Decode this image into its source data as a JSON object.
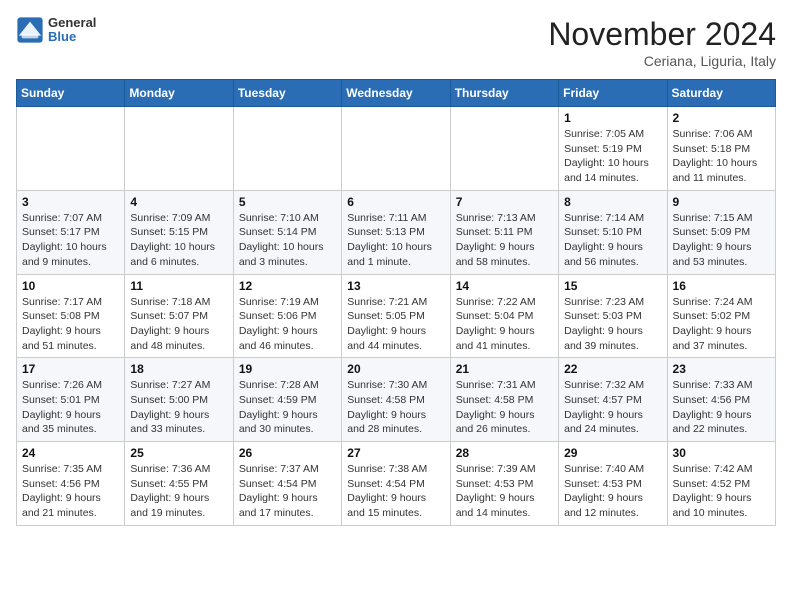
{
  "header": {
    "logo": {
      "general": "General",
      "blue": "Blue"
    },
    "month": "November 2024",
    "location": "Ceriana, Liguria, Italy"
  },
  "weekdays": [
    "Sunday",
    "Monday",
    "Tuesday",
    "Wednesday",
    "Thursday",
    "Friday",
    "Saturday"
  ],
  "weeks": [
    [
      {
        "day": "",
        "info": ""
      },
      {
        "day": "",
        "info": ""
      },
      {
        "day": "",
        "info": ""
      },
      {
        "day": "",
        "info": ""
      },
      {
        "day": "",
        "info": ""
      },
      {
        "day": "1",
        "info": "Sunrise: 7:05 AM\nSunset: 5:19 PM\nDaylight: 10 hours and 14 minutes."
      },
      {
        "day": "2",
        "info": "Sunrise: 7:06 AM\nSunset: 5:18 PM\nDaylight: 10 hours and 11 minutes."
      }
    ],
    [
      {
        "day": "3",
        "info": "Sunrise: 7:07 AM\nSunset: 5:17 PM\nDaylight: 10 hours and 9 minutes."
      },
      {
        "day": "4",
        "info": "Sunrise: 7:09 AM\nSunset: 5:15 PM\nDaylight: 10 hours and 6 minutes."
      },
      {
        "day": "5",
        "info": "Sunrise: 7:10 AM\nSunset: 5:14 PM\nDaylight: 10 hours and 3 minutes."
      },
      {
        "day": "6",
        "info": "Sunrise: 7:11 AM\nSunset: 5:13 PM\nDaylight: 10 hours and 1 minute."
      },
      {
        "day": "7",
        "info": "Sunrise: 7:13 AM\nSunset: 5:11 PM\nDaylight: 9 hours and 58 minutes."
      },
      {
        "day": "8",
        "info": "Sunrise: 7:14 AM\nSunset: 5:10 PM\nDaylight: 9 hours and 56 minutes."
      },
      {
        "day": "9",
        "info": "Sunrise: 7:15 AM\nSunset: 5:09 PM\nDaylight: 9 hours and 53 minutes."
      }
    ],
    [
      {
        "day": "10",
        "info": "Sunrise: 7:17 AM\nSunset: 5:08 PM\nDaylight: 9 hours and 51 minutes."
      },
      {
        "day": "11",
        "info": "Sunrise: 7:18 AM\nSunset: 5:07 PM\nDaylight: 9 hours and 48 minutes."
      },
      {
        "day": "12",
        "info": "Sunrise: 7:19 AM\nSunset: 5:06 PM\nDaylight: 9 hours and 46 minutes."
      },
      {
        "day": "13",
        "info": "Sunrise: 7:21 AM\nSunset: 5:05 PM\nDaylight: 9 hours and 44 minutes."
      },
      {
        "day": "14",
        "info": "Sunrise: 7:22 AM\nSunset: 5:04 PM\nDaylight: 9 hours and 41 minutes."
      },
      {
        "day": "15",
        "info": "Sunrise: 7:23 AM\nSunset: 5:03 PM\nDaylight: 9 hours and 39 minutes."
      },
      {
        "day": "16",
        "info": "Sunrise: 7:24 AM\nSunset: 5:02 PM\nDaylight: 9 hours and 37 minutes."
      }
    ],
    [
      {
        "day": "17",
        "info": "Sunrise: 7:26 AM\nSunset: 5:01 PM\nDaylight: 9 hours and 35 minutes."
      },
      {
        "day": "18",
        "info": "Sunrise: 7:27 AM\nSunset: 5:00 PM\nDaylight: 9 hours and 33 minutes."
      },
      {
        "day": "19",
        "info": "Sunrise: 7:28 AM\nSunset: 4:59 PM\nDaylight: 9 hours and 30 minutes."
      },
      {
        "day": "20",
        "info": "Sunrise: 7:30 AM\nSunset: 4:58 PM\nDaylight: 9 hours and 28 minutes."
      },
      {
        "day": "21",
        "info": "Sunrise: 7:31 AM\nSunset: 4:58 PM\nDaylight: 9 hours and 26 minutes."
      },
      {
        "day": "22",
        "info": "Sunrise: 7:32 AM\nSunset: 4:57 PM\nDaylight: 9 hours and 24 minutes."
      },
      {
        "day": "23",
        "info": "Sunrise: 7:33 AM\nSunset: 4:56 PM\nDaylight: 9 hours and 22 minutes."
      }
    ],
    [
      {
        "day": "24",
        "info": "Sunrise: 7:35 AM\nSunset: 4:56 PM\nDaylight: 9 hours and 21 minutes."
      },
      {
        "day": "25",
        "info": "Sunrise: 7:36 AM\nSunset: 4:55 PM\nDaylight: 9 hours and 19 minutes."
      },
      {
        "day": "26",
        "info": "Sunrise: 7:37 AM\nSunset: 4:54 PM\nDaylight: 9 hours and 17 minutes."
      },
      {
        "day": "27",
        "info": "Sunrise: 7:38 AM\nSunset: 4:54 PM\nDaylight: 9 hours and 15 minutes."
      },
      {
        "day": "28",
        "info": "Sunrise: 7:39 AM\nSunset: 4:53 PM\nDaylight: 9 hours and 14 minutes."
      },
      {
        "day": "29",
        "info": "Sunrise: 7:40 AM\nSunset: 4:53 PM\nDaylight: 9 hours and 12 minutes."
      },
      {
        "day": "30",
        "info": "Sunrise: 7:42 AM\nSunset: 4:52 PM\nDaylight: 9 hours and 10 minutes."
      }
    ]
  ]
}
